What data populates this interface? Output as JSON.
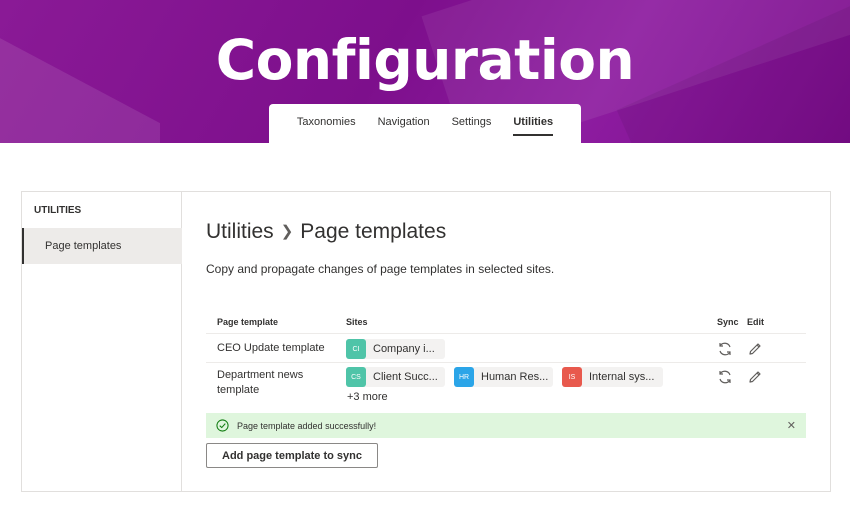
{
  "banner": {
    "title": "Configuration"
  },
  "tabs": [
    {
      "label": "Taxonomies"
    },
    {
      "label": "Navigation"
    },
    {
      "label": "Settings"
    },
    {
      "label": "Utilities",
      "active": true
    }
  ],
  "sidebar": {
    "heading": "UTILITIES",
    "items": [
      {
        "label": "Page templates",
        "selected": true
      }
    ]
  },
  "main": {
    "breadcrumb_parent": "Utilities",
    "breadcrumb_current": "Page templates",
    "description": "Copy and propagate changes of page templates in selected sites."
  },
  "table": {
    "columns": {
      "template": "Page template",
      "sites": "Sites",
      "sync": "Sync",
      "edit": "Edit"
    },
    "rows": [
      {
        "name": "CEO Update template",
        "sites": [
          {
            "initials": "CI",
            "label": "Company i...",
            "color": "#4fc4a8"
          }
        ]
      },
      {
        "name_line1": "Department news",
        "name_line2": "template",
        "sites": [
          {
            "initials": "CS",
            "label": "Client Succ...",
            "color": "#4fc4a8"
          },
          {
            "initials": "HR",
            "label": "Human Res...",
            "color": "#2ba5e8"
          },
          {
            "initials": "IS",
            "label": "Internal sys...",
            "color": "#e8594d"
          }
        ],
        "more": "+3 more"
      }
    ]
  },
  "toast": {
    "message": "Page template added successfully!",
    "color": "#dff6dd"
  },
  "actions": {
    "add_button": "Add page template to sync"
  },
  "icons": {
    "sync": "sync-icon",
    "edit": "pencil-icon",
    "success": "checkmark-circle-icon",
    "dismiss": "close-icon"
  }
}
